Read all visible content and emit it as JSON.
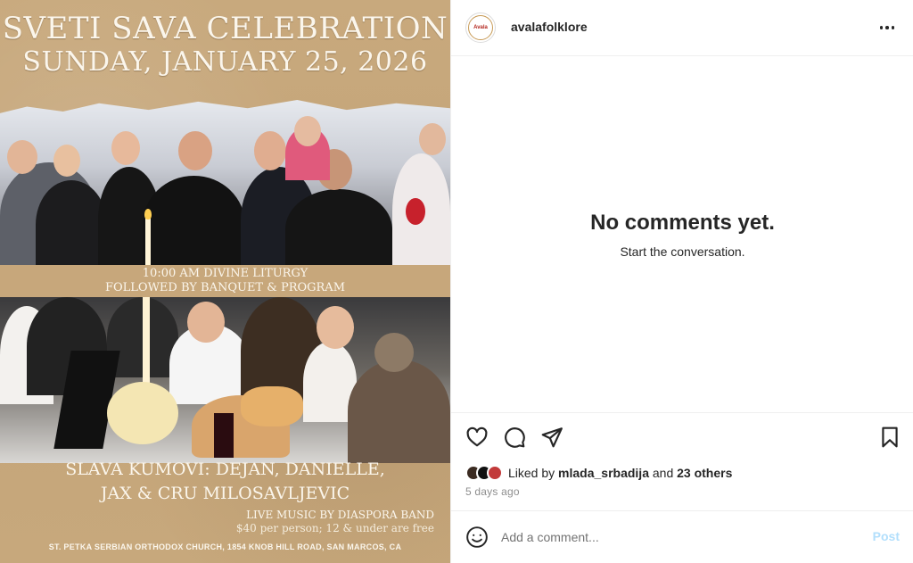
{
  "poster": {
    "title_line1": "SVETI SAVA CELEBRATION",
    "title_line2": "SUNDAY, JANUARY 25, 2026",
    "band_line1": "10:00 AM DIVINE LITURGY",
    "band_line2": "FOLLOWED BY BANQUET & PROGRAM",
    "kumovi_line1": "SLAVA KUMOVI: DEJAN, DANIELLE,",
    "kumovi_line2": "JAX & CRU MILOSAVLJEVIC",
    "music": "LIVE MUSIC BY DIASPORA BAND",
    "price": "$40 per person; 12 & under are free",
    "address": "ST. PETKA SERBIAN ORTHODOX CHURCH, 1854 KNOB HILL ROAD, SAN MARCOS, CA"
  },
  "header": {
    "avatar_text": "Avala",
    "username": "avalafolklore",
    "more_icon": "more-horizontal-icon"
  },
  "comments": {
    "empty_title": "No comments yet.",
    "empty_subtitle": "Start the conversation."
  },
  "actions": {
    "like_icon": "heart-icon",
    "comment_icon": "comment-icon",
    "share_icon": "send-icon",
    "save_icon": "bookmark-icon",
    "liked_prefix": "Liked by ",
    "liked_user": "mlada_srbadija",
    "liked_and": " and ",
    "liked_others": "23 others",
    "time_ago": "5 days ago"
  },
  "comment_bar": {
    "emoji_icon": "emoji-icon",
    "placeholder": "Add a comment...",
    "post_label": "Post"
  },
  "colors": {
    "kraft": "#c7a77b",
    "text_primary": "#262626",
    "text_secondary": "#8e8e8e",
    "post_disabled": "#b2dffc"
  }
}
